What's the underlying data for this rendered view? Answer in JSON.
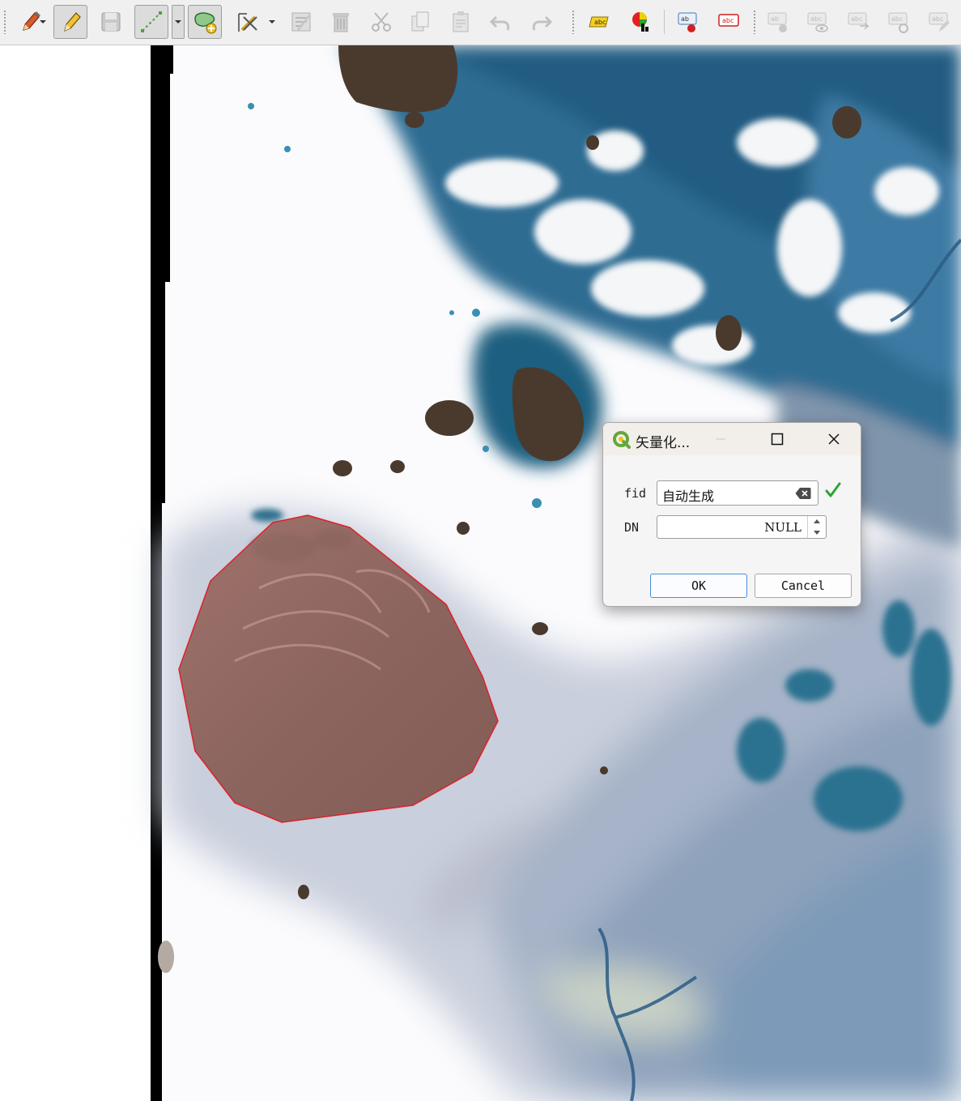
{
  "toolbar": {
    "icons": [
      "edit-pencil-colored-icon",
      "toggle-editing-pencil-icon",
      "save-layer-edits-icon",
      "digitize-line-icon",
      "add-polygon-feature-icon",
      "vertex-tool-icon",
      "modify-attributes-icon",
      "delete-selected-icon",
      "cut-features-icon",
      "copy-features-icon",
      "paste-features-icon",
      "undo-icon",
      "redo-icon",
      "label-tool-icon",
      "diagram-icon",
      "pin-label-icon",
      "highlight-label-icon",
      "move-label-icon",
      "show-hide-label-icon",
      "rotate-label-icon",
      "change-label-icon",
      "edit-label-icon"
    ],
    "active": [
      "toggle-editing-pencil-icon",
      "add-polygon-feature-icon"
    ]
  },
  "dialog": {
    "title": "矢量化...",
    "fields": [
      {
        "label": "fid",
        "value": "自动生成"
      },
      {
        "label": "DN",
        "value": "NULL"
      }
    ],
    "ok_label": "OK",
    "cancel_label": "Cancel"
  },
  "colors": {
    "polygon_fill": "#8a5a52",
    "polygon_stroke": "#e0202a",
    "water_deep": "#1f5f80",
    "water_light": "#6f9fc4",
    "accent_blue": "#4a8fd8",
    "check_green": "#2fa336"
  }
}
